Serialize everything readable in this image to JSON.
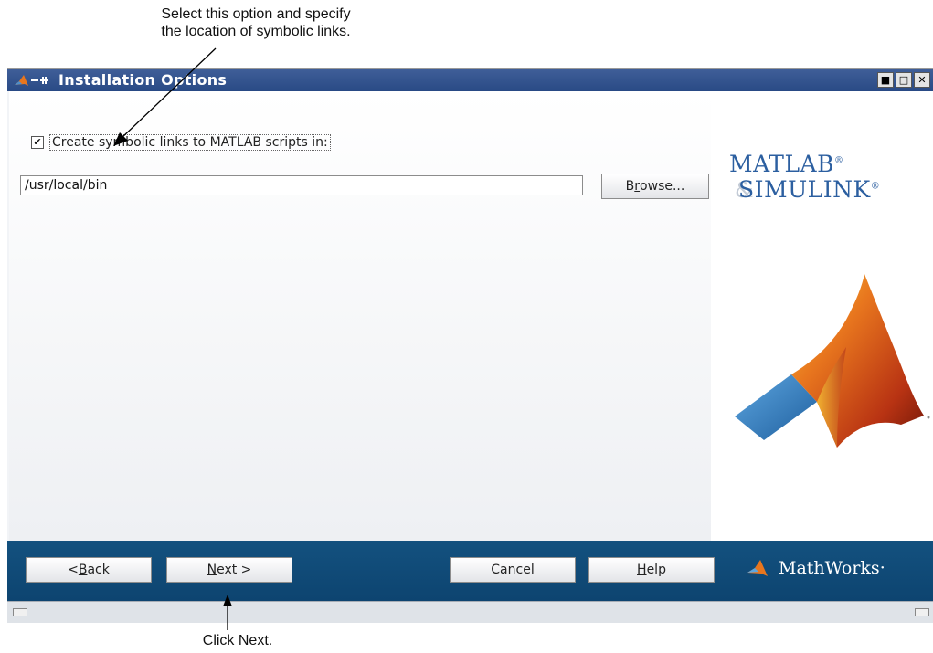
{
  "annotations": {
    "top_line1": "Select this option and specify",
    "top_line2": "the location of symbolic links.",
    "bottom": "Click Next."
  },
  "window": {
    "title": "Installation Options",
    "controls": [
      "■",
      "□",
      "✕"
    ]
  },
  "options": {
    "create_links_checked": true,
    "create_links_label": "Create symbolic links to MATLAB scripts in:",
    "path_value": "/usr/local/bin",
    "browse_label_pre": "B",
    "browse_label_mnemonic": "r",
    "browse_label_post": "owse..."
  },
  "logo": {
    "line1": "MATLAB",
    "line1_mark": "®",
    "amp": "&",
    "line2": "SIMULINK",
    "line2_mark": "®",
    "colors": {
      "text": "#2c5fa0",
      "peak_orange": "#e8761e",
      "peak_red": "#8a1d0d",
      "blue": "#3f8ac8"
    }
  },
  "footer": {
    "back_pre": "< ",
    "back_mnemonic": "B",
    "back_post": "ack",
    "next_mnemonic": "N",
    "next_post": "ext >",
    "cancel": "Cancel",
    "help_mnemonic": "H",
    "help_post": "elp",
    "brand": "MathWorks",
    "brand_mark": "·"
  }
}
